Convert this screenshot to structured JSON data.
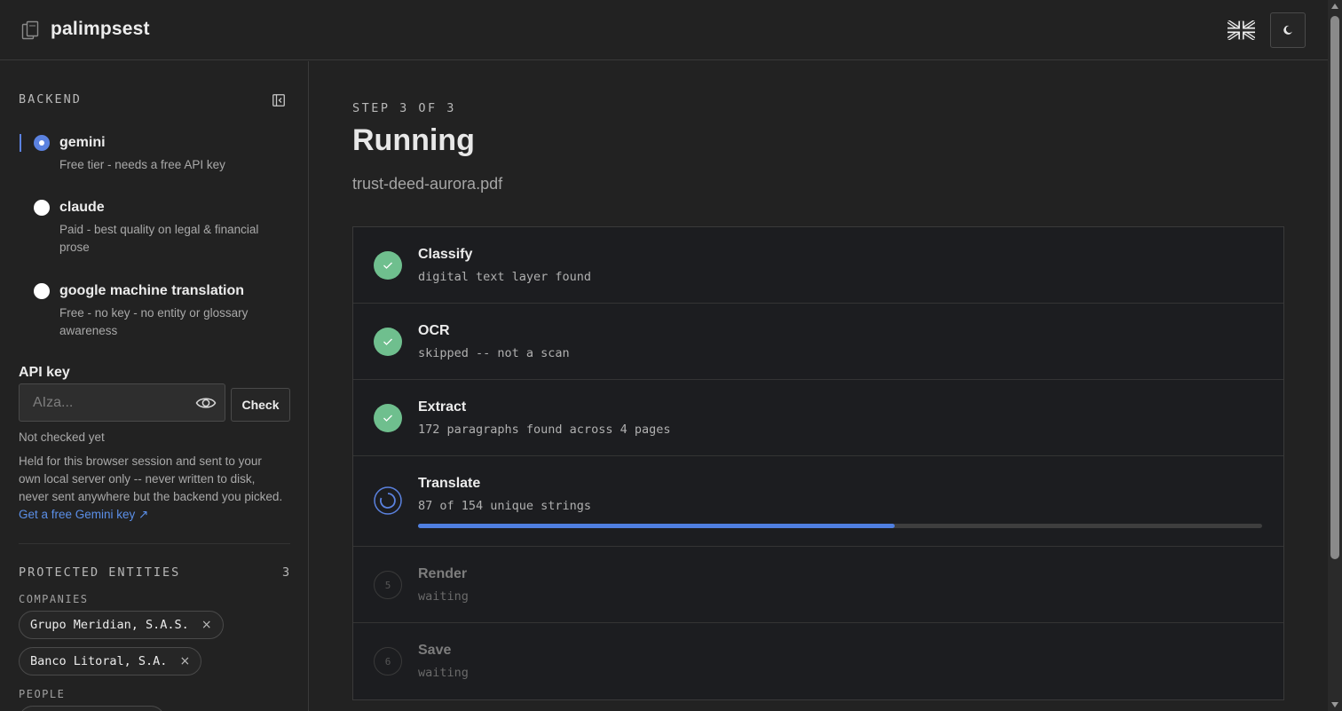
{
  "header": {
    "title": "palimpsest",
    "logo_icon": "stacked-pages-icon",
    "language_icon": "uk-flag-icon",
    "theme_icon": "moon-icon"
  },
  "sidebar": {
    "backend_label": "BACKEND",
    "backends": [
      {
        "name": "gemini",
        "desc": "Free tier - needs a free API key",
        "selected": true
      },
      {
        "name": "claude",
        "desc": "Paid - best quality on legal & financial prose",
        "selected": false
      },
      {
        "name": "google machine translation",
        "desc": "Free - no key - no entity or glossary awareness",
        "selected": false
      }
    ],
    "api_key_label": "API key",
    "api_key_placeholder": "AIza...",
    "api_key_value": "",
    "check_label": "Check",
    "status": "Not checked yet",
    "help_text": "Held for this browser session and sent to your own local server only -- never written to disk, never sent anywhere but the backend you picked.",
    "help_link": "Get a free Gemini key ↗",
    "entities_label": "PROTECTED ENTITIES",
    "entities_count": "3",
    "companies_label": "COMPANIES",
    "companies": [
      "Grupo Meridian, S.A.S.",
      "Banco Litoral, S.A."
    ],
    "people_label": "PEOPLE"
  },
  "main": {
    "step_label": "STEP 3 OF 3",
    "title": "Running",
    "file_name": "trust-deed-aurora.pdf",
    "steps": [
      {
        "name": "Classify",
        "detail": "digital text layer found",
        "status": "done"
      },
      {
        "name": "OCR",
        "detail": "skipped -- not a scan",
        "status": "done"
      },
      {
        "name": "Extract",
        "detail": "172 paragraphs found across 4 pages",
        "status": "done"
      },
      {
        "name": "Translate",
        "detail": "87 of 154 unique strings",
        "status": "running",
        "progress": 0.565
      },
      {
        "name": "Render",
        "detail": "waiting",
        "status": "waiting",
        "number": "5"
      },
      {
        "name": "Save",
        "detail": "waiting",
        "status": "waiting",
        "number": "6"
      }
    ]
  },
  "colors": {
    "accent": "#5b82e0",
    "done": "#6fbf8e",
    "background": "#222222"
  }
}
